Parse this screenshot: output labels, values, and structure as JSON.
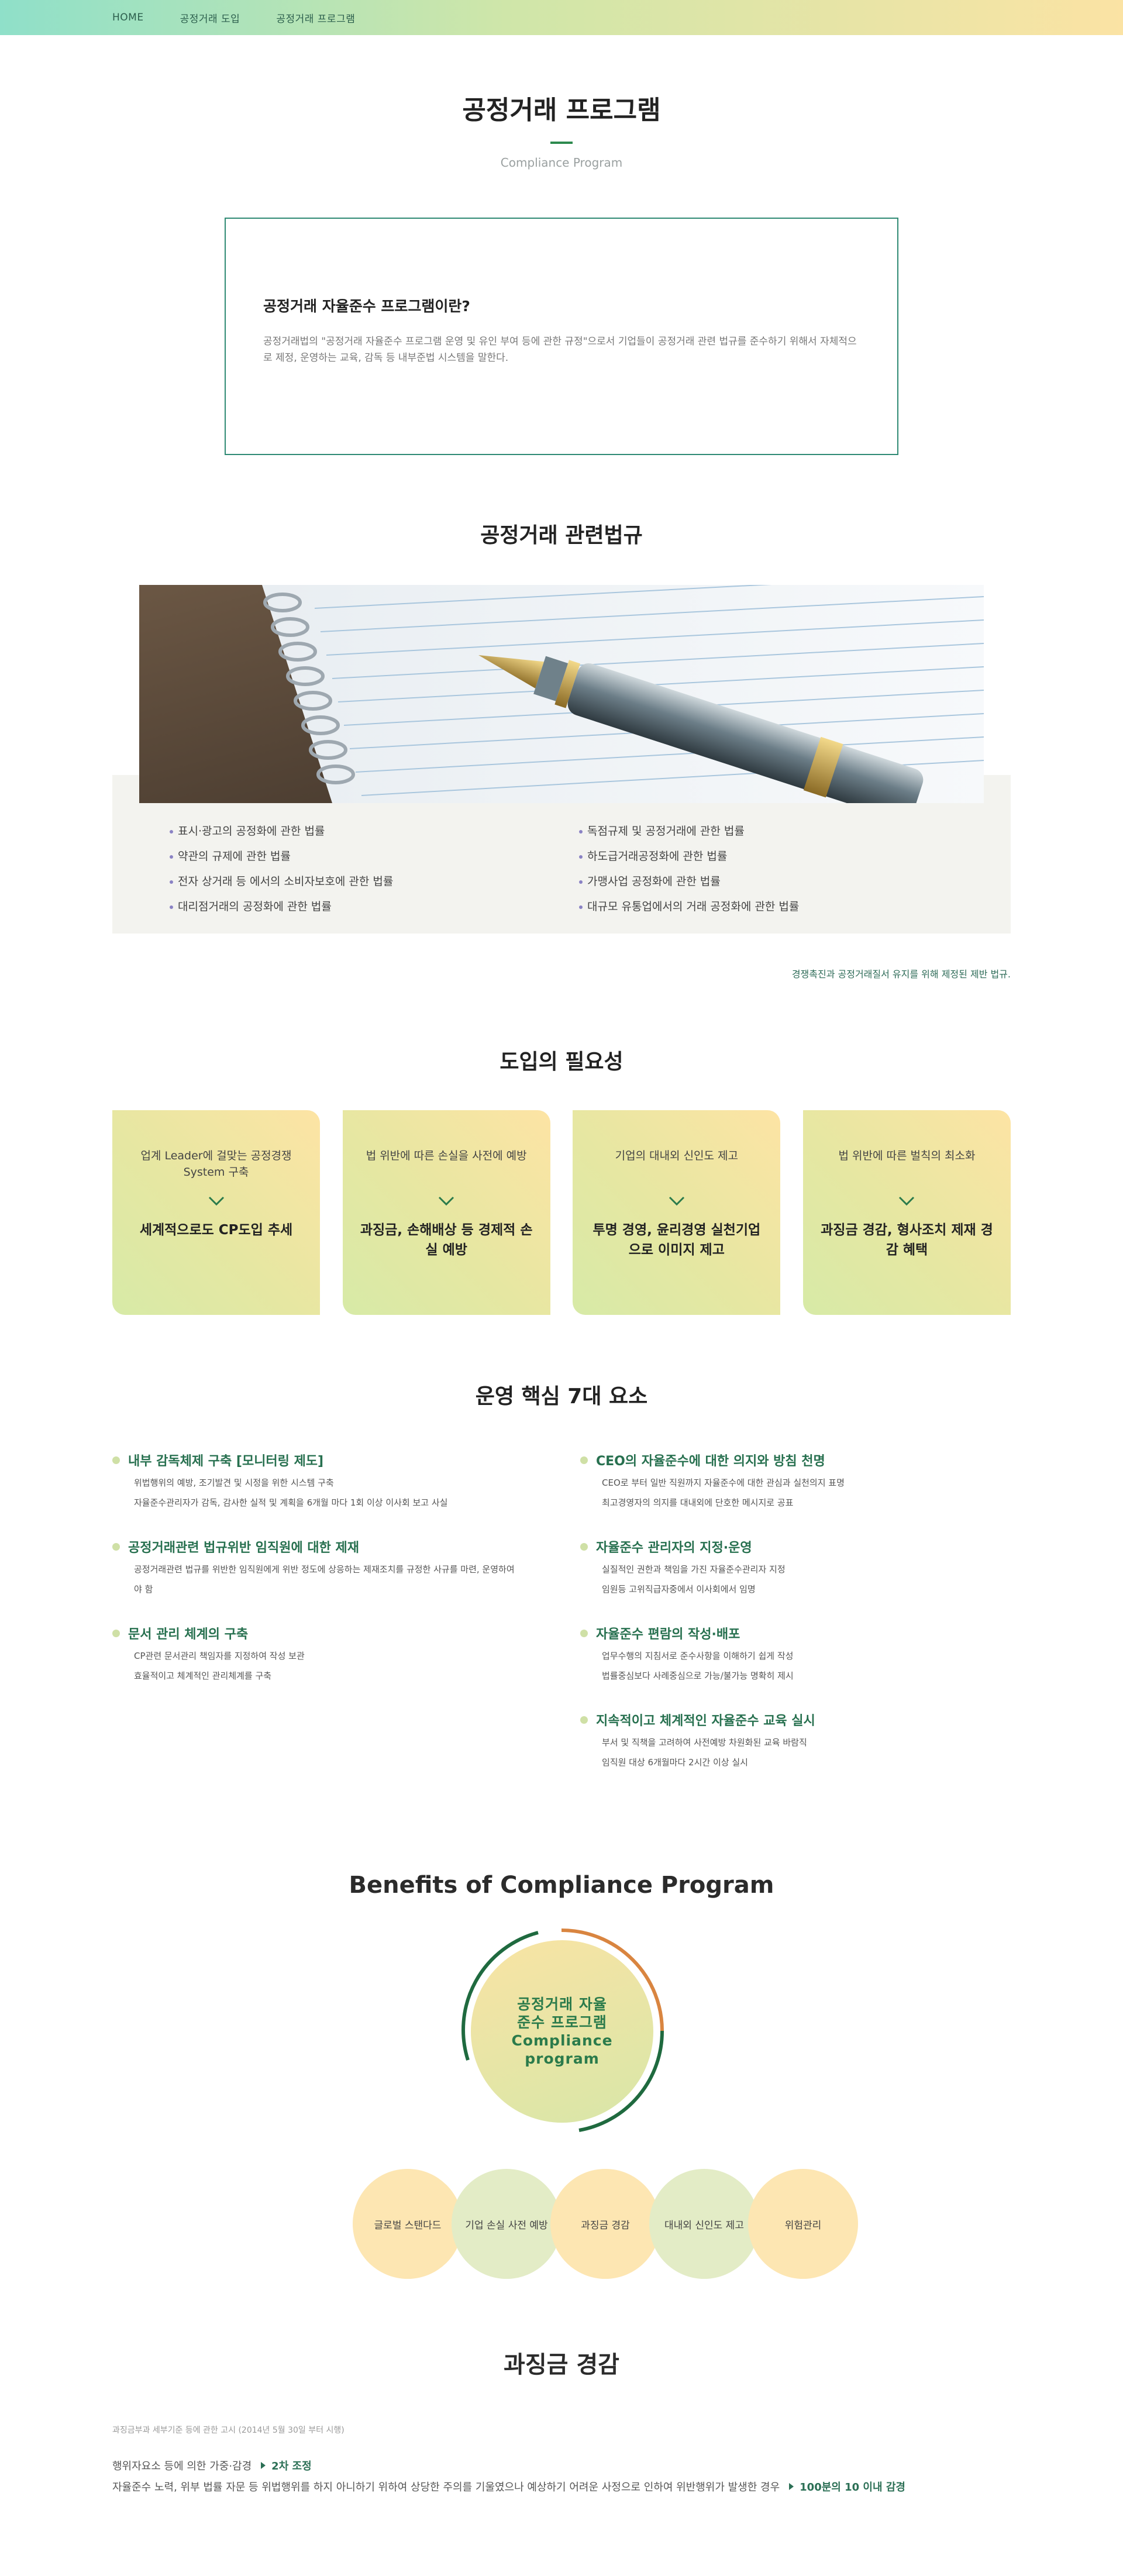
{
  "nav": {
    "items": [
      "HOME",
      "공정거래 도입",
      "공정거래 프로그램"
    ]
  },
  "header": {
    "title": "공정거래 프로그램",
    "subtitle": "Compliance Program"
  },
  "intro": {
    "heading": "공정거래 자율준수 프로그램이란?",
    "body": "공정거래법의 \"공정거래 자율준수 프로그램 운영 및 유인 부여 등에 관한 규정\"으로서 기업들이 공정거래 관련 법규를 준수하기 위해서 자체적으로 제정, 운영하는 교육, 감독 등 내부준법 시스템을 말한다."
  },
  "laws": {
    "title": "공정거래 관련법규",
    "left": [
      "표시·광고의 공정화에 관한 법률",
      "약관의 규제에 관한 법률",
      "전자 상거래 등 에서의 소비자보호에 관한 법률",
      "대리점거래의 공정화에 관한 법률"
    ],
    "right": [
      "독점규제 및 공정거래에 관한 법률",
      "하도급거래공정화에 관한 법률",
      "가맹사업 공정화에 관한 법률",
      "대규모 유통업에서의 거래 공정화에 관한 법률"
    ],
    "note": "경쟁촉진과 공정거래질서 유지를 위해 제정된 제반 법규."
  },
  "necessity": {
    "title": "도입의 필요성",
    "cards": [
      {
        "top": "업계 Leader에 걸맞는 공정경쟁 System 구축",
        "bottom": "세계적으로도 CP도입 추세"
      },
      {
        "top": "법 위반에 따른 손실을 사전에 예방",
        "bottom": "과징금, 손해배상 등 경제적 손실 예방"
      },
      {
        "top": "기업의 대내외 신인도 제고",
        "bottom": "투명 경영, 윤리경영 실천기업으로 이미지 제고"
      },
      {
        "top": "법 위반에 따른 벌칙의 최소화",
        "bottom": "과징금 경감, 형사조치 제재 경감 혜택"
      }
    ]
  },
  "elements": {
    "title": "운영 핵심 7대 요소",
    "items": [
      {
        "head": "내부 감독체제 구축 [모니터링 제도]",
        "lines": [
          "위법행위의 예방, 조기발견 및 시정을 위한 시스템 구축",
          "자율준수관리자가 감독, 감사한 실적 및 계획을 6개월 마다 1회 이상 이사회 보고 사실"
        ]
      },
      {
        "head": "CEO의 자율준수에 대한 의지와 방침 천명",
        "lines": [
          "CEO로 부터 일반 직원까지 자율준수에 대한 관심과 실천의지 표명",
          "최고경영자의 의지를 대내외에 단호한 메시지로 공표"
        ]
      },
      {
        "head": "공정거래관련 법규위반 임직원에 대한 제재",
        "lines": [
          "공정거래관련 법규를 위반한 임직원에게 위반 정도에 상응하는 제재조치를 규정한 사규를 마련, 운영하여야 함"
        ]
      },
      {
        "head": "자율준수 관리자의 지정·운영",
        "lines": [
          "실질적인 권한과 책임을 가진 자율준수관리자 지정",
          "임원등 고위직급자중에서 이사회에서 임명"
        ]
      },
      {
        "head": "문서 관리 체계의 구축",
        "lines": [
          "CP관련 문서관리 책임자를 지정하여 작성 보관",
          "효율적이고 체계적인 관리체계를 구축"
        ]
      },
      {
        "head": "자율준수 편람의 작성·배포",
        "lines": [
          "업무수행의 지침서로 준수사항을 이해하기 쉽게 작성",
          "법률중심보다 사례중심으로 가능/불가능 명확히 제시"
        ]
      },
      {
        "head": "지속적이고 체계적인 자율준수 교육 실시",
        "lines": [
          "부서 및 직책을 고려하여 사전예방 차원화된 교육 바람직",
          "임직원 대상 6개월마다 2시간 이상 실시"
        ]
      }
    ]
  },
  "benefits": {
    "title": "Benefits of Compliance Program",
    "center": "공정거래 자율준수 프로그램 Compliance program",
    "items": [
      "글로벌 스탠다드",
      "기업 손실 사전 예방",
      "과징금 경감",
      "대내외 신인도 제고",
      "위험관리"
    ],
    "colors": [
      "#fde6b2",
      "#e3ecc6",
      "#fde6b2",
      "#e3ecc6",
      "#fde6b2"
    ]
  },
  "penalty": {
    "title": "과징금 경감",
    "source": "과징금부과 세부기준 등에 관한 고시 (2014년 5월 30일 부터 시행)",
    "row1_text": "행위자요소 등에 의한 가중·감경",
    "row1_highlight": "2차 조정",
    "row2_text": "자율준수 노력, 위부 법률 자문 등 위법행위를 하지 아니하기 위하여 상당한 주의를 기울였으나 예상하기 어려운 사정으로 인하여 위반행위가 발생한 경우",
    "row2_highlight": "100분의 10 이내 감경"
  }
}
